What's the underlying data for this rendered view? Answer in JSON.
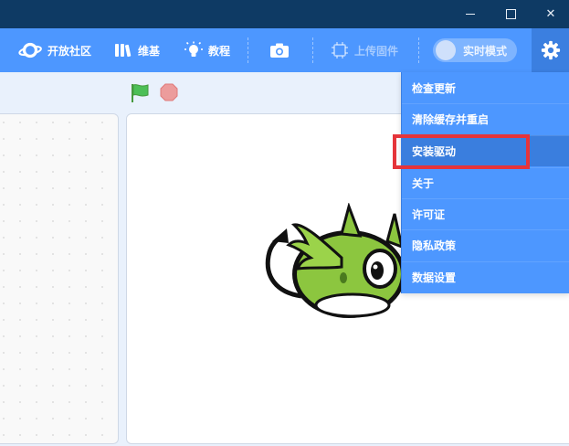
{
  "window": {
    "controls": {
      "minimize_icon": "minimize-icon",
      "maximize_icon": "maximize-icon",
      "close_icon": "close-icon",
      "close_glyph": "✕"
    }
  },
  "toolbar": {
    "community_label": "开放社区",
    "wiki_label": "维基",
    "tutorial_label": "教程",
    "screenshot_icon": "camera-icon",
    "upload_label": "上传固件",
    "live_mode_label": "实时模式",
    "settings_icon": "gear-icon"
  },
  "stage_controls": {
    "go_icon": "green-flag-icon",
    "stop_icon": "stop-icon"
  },
  "settings_menu": {
    "items": [
      {
        "label": "检查更新"
      },
      {
        "label": "清除缓存并重启"
      },
      {
        "label": "安装驱动",
        "highlighted": true
      },
      {
        "label": "关于"
      },
      {
        "label": "许可证"
      },
      {
        "label": "隐私政策"
      },
      {
        "label": "数据设置"
      }
    ]
  },
  "colors": {
    "titlebar": "#0e3a64",
    "toolbar": "#4d97ff",
    "menu_hover": "#3a7ede",
    "annotation_box": "#e5343a",
    "flag_green": "#4cbf56",
    "stop_red": "#ec9c9c"
  }
}
